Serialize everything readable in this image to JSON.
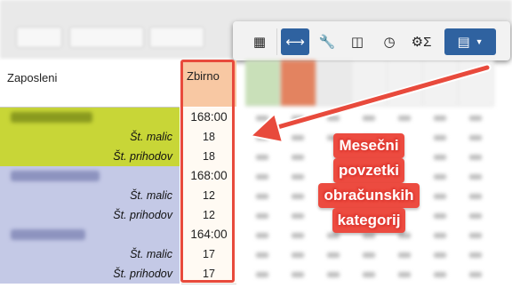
{
  "toolbar": {
    "buttons": [
      {
        "icon": "grid-icon",
        "glyph": "▦"
      },
      {
        "icon": "expand-horizontal-icon",
        "glyph": "⟷"
      },
      {
        "icon": "wrench-icon",
        "glyph": "🔧"
      },
      {
        "icon": "columns-icon",
        "glyph": "◫"
      },
      {
        "icon": "clock-icon",
        "glyph": "◷"
      },
      {
        "icon": "sum-icon",
        "glyph": "⚙Σ"
      },
      {
        "icon": "calculator-icon",
        "glyph": "▤"
      }
    ],
    "accent": "#2f62a0"
  },
  "table": {
    "employee_header": "Zaposleni",
    "summary_header": "Zbirno",
    "groups": [
      {
        "total": "168:00",
        "rows": [
          {
            "label": "Št. malic",
            "value": "18"
          },
          {
            "label": "Št. prihodov",
            "value": "18"
          }
        ],
        "color": "#c8d637"
      },
      {
        "total": "168:00",
        "rows": [
          {
            "label": "Št. malic",
            "value": "12"
          },
          {
            "label": "Št. prihodov",
            "value": "12"
          }
        ],
        "color": "#c4c9e6"
      },
      {
        "total": "164:00",
        "rows": [
          {
            "label": "Št. malic",
            "value": "17"
          },
          {
            "label": "Št. prihodov",
            "value": "17"
          }
        ],
        "color": "#c4c9e6"
      }
    ]
  },
  "callout": {
    "lines": [
      "Mesečni",
      "povzetki",
      "obračunskih",
      "kategorij"
    ],
    "color": "#e84a3c"
  }
}
